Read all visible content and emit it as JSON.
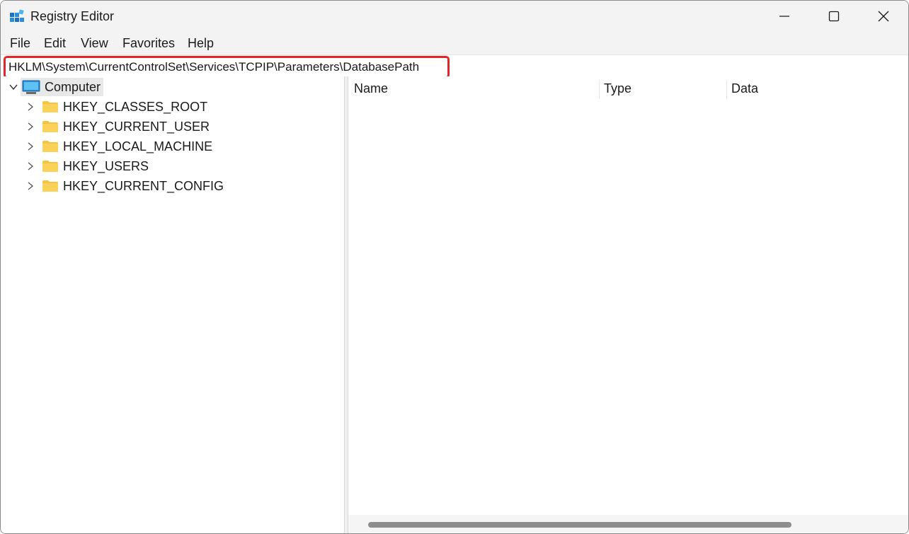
{
  "window": {
    "title": "Registry Editor"
  },
  "menu": [
    "File",
    "Edit",
    "View",
    "Favorites",
    "Help"
  ],
  "address": {
    "value": "HKLM\\System\\CurrentControlSet\\Services\\TCPIP\\Parameters\\DatabasePath"
  },
  "tree": {
    "root": "Computer",
    "hives": [
      "HKEY_CLASSES_ROOT",
      "HKEY_CURRENT_USER",
      "HKEY_LOCAL_MACHINE",
      "HKEY_USERS",
      "HKEY_CURRENT_CONFIG"
    ]
  },
  "list": {
    "columns": [
      "Name",
      "Type",
      "Data"
    ]
  },
  "colors": {
    "highlight_border": "#e0262b",
    "folder": "#f5c542",
    "monitor": "#2b8fd6"
  },
  "icons": {
    "app": "registry-editor-icon",
    "root": "computer-icon",
    "hive": "folder-icon"
  }
}
